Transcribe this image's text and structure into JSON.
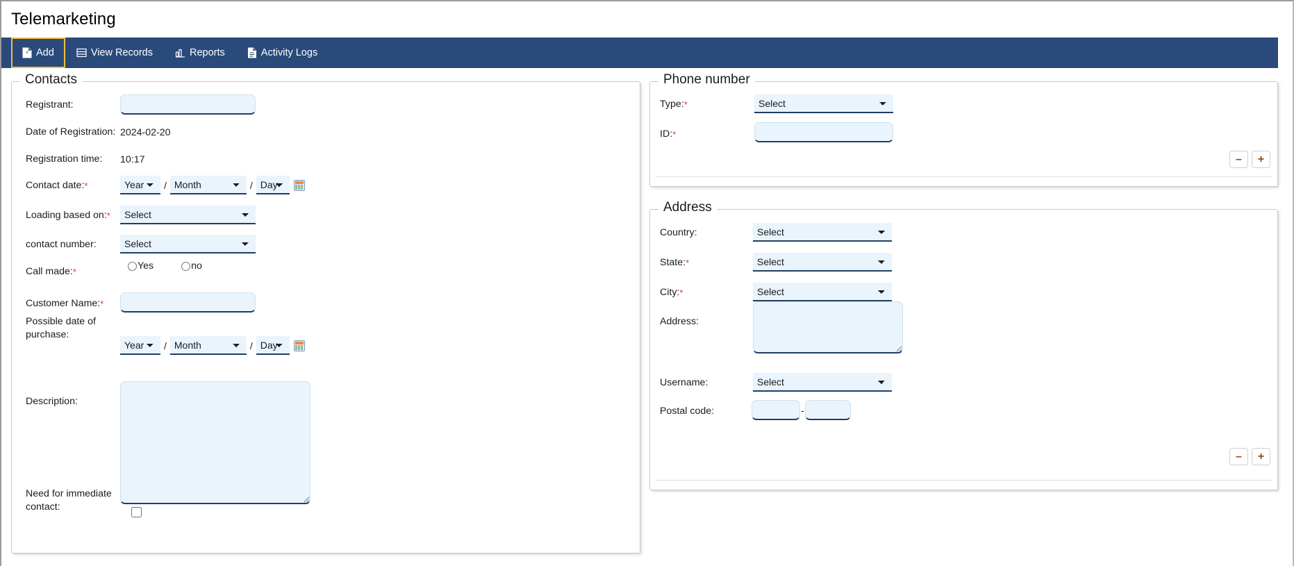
{
  "app": {
    "title": "Telemarketing"
  },
  "nav": {
    "items": [
      {
        "label": "Add",
        "icon": "file-add-icon",
        "active": true
      },
      {
        "label": "View Records",
        "icon": "list-records-icon",
        "active": false
      },
      {
        "label": "Reports",
        "icon": "bar-chart-icon",
        "active": false
      },
      {
        "label": "Activity Logs",
        "icon": "document-log-icon",
        "active": false
      }
    ]
  },
  "colors": {
    "navbar": "#2a4a7b",
    "active_tab_outline": "#f0c03c",
    "field_bg": "#e9f4fd",
    "field_underline": "#1f3d63",
    "required_mark": "#d13d3d",
    "pm_button_glyph": "#8a4a1e"
  },
  "contacts": {
    "legend": "Contacts",
    "registrant": {
      "label": "Registrant:",
      "value": "",
      "placeholder": ""
    },
    "date_of_registration": {
      "label": "Date of Registration:",
      "value": "2024-02-20"
    },
    "registration_time": {
      "label": "Registration time:",
      "value": "10:17"
    },
    "contact_date": {
      "label": "Contact date:",
      "required": "*",
      "year": "Year",
      "month": "Month",
      "day": "Day",
      "separator": "/",
      "calendar_icon": "calendar-icon"
    },
    "loading_based_on": {
      "label": "Loading based on:",
      "required": "*",
      "value": "Select"
    },
    "contact_number": {
      "label": "contact number:",
      "value": "Select"
    },
    "call_made": {
      "label": "Call made:",
      "required": "*",
      "options": [
        "Yes",
        "no"
      ],
      "selected": ""
    },
    "customer_name": {
      "label": "Customer Name:",
      "required": "*",
      "value": ""
    },
    "possible_date_of_purchase": {
      "label": "Possible date of purchase:",
      "line1": "Possible date of",
      "line2": "purchase:",
      "year": "Year",
      "month": "Month",
      "day": "Day",
      "separator": "/",
      "calendar_icon": "calendar-icon"
    },
    "description": {
      "label": "Description:",
      "value": ""
    },
    "need_immediate_contact": {
      "label": "Need for immediate contact:",
      "line1": "Need for immediate",
      "line2": "contact:",
      "checked": false
    }
  },
  "phone": {
    "legend": "Phone number",
    "type": {
      "label": "Type:",
      "required": "*",
      "value": "Select"
    },
    "id": {
      "label": "ID:",
      "required": "*",
      "value": ""
    },
    "remove_label": "–",
    "add_label": "+"
  },
  "address": {
    "legend": "Address",
    "country": {
      "label": "Country:",
      "value": "Select"
    },
    "state": {
      "label": "State:",
      "required": "*",
      "value": "Select"
    },
    "city": {
      "label": "City:",
      "required": "*",
      "value": "Select"
    },
    "address": {
      "label": "Address:",
      "value": ""
    },
    "username": {
      "label": "Username:",
      "value": "Select"
    },
    "postal_code": {
      "label": "Postal code:",
      "part1": "",
      "part2": "",
      "separator": "-"
    },
    "remove_label": "–",
    "add_label": "+"
  }
}
